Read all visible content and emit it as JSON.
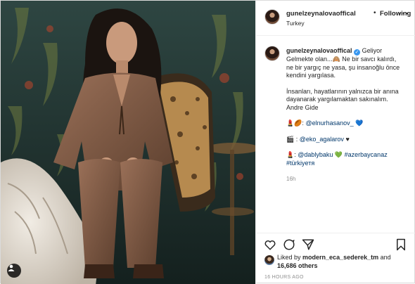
{
  "post": {
    "username": "gunelzeynalovaoffical",
    "follow_state": "Following",
    "separator": "•",
    "location": "Turkey",
    "more_icon": "more-options-icon",
    "caption": {
      "line1": "Geliyor",
      "line2": "Gelmekte olan...",
      "line2b": "Ne bir savcı kalırdı,",
      "line3": "ne bir yargıç ne yasa, şu insanoğlu önce",
      "line4": "kendini yargılasa.",
      "para2_l1": "İnsanları, hayatlarının yalnızca bir anına",
      "para2_l2": "dayanarak yargılamaktan sakınalım.",
      "para2_l3": "Andre Gide",
      "credit1_mention": "@elnurhasanov_",
      "credit2_mention": "@eko_agalarov",
      "credit3_mention": "@dablybaku",
      "credit3_tag": "#azerbaycanaz",
      "credit3_tag2": "#türkiyетя",
      "age": "16h"
    },
    "likes": {
      "prefix": "Liked by",
      "user": "modern_eca_sederek_tm",
      "and": "and",
      "count": "16,686 others"
    },
    "timestamp": "16 HOURS AGO"
  },
  "colors": {
    "accent": "#3897f0",
    "link": "#00376b",
    "muted": "#8e8e8e"
  }
}
